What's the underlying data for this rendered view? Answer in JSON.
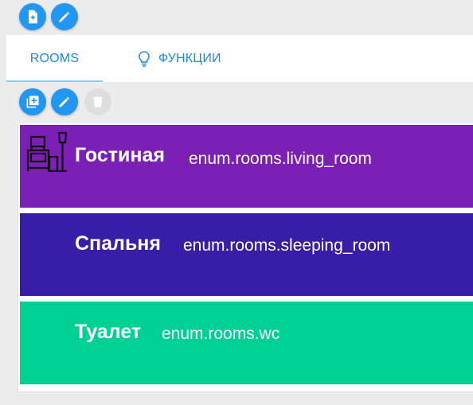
{
  "toolbar_top": {
    "icons": [
      "add-file-icon",
      "edit-pencil-icon"
    ]
  },
  "tabs": [
    {
      "label": "ROOMS",
      "active": true
    },
    {
      "label": "ФУНКЦИИ",
      "active": false,
      "icon": "lightbulb-icon"
    }
  ],
  "toolbar_list": {
    "icons": [
      "add-copy-icon",
      "edit-pencil-icon",
      "delete-trash-icon"
    ]
  },
  "rooms": [
    {
      "name": "Гостиная",
      "id": "enum.rooms.living_room",
      "color": "#7b1fb5",
      "icon": "living-room-icon"
    },
    {
      "name": "Спальня",
      "id": "enum.rooms.sleeping_room",
      "color": "#361ea6",
      "icon": ""
    },
    {
      "name": "Туалет",
      "id": "enum.rooms.wc",
      "color": "#00d094",
      "icon": ""
    }
  ],
  "colors": {
    "accent": "#2196f3",
    "tab_text": "#1e88e5",
    "disabled": "#dedede"
  }
}
